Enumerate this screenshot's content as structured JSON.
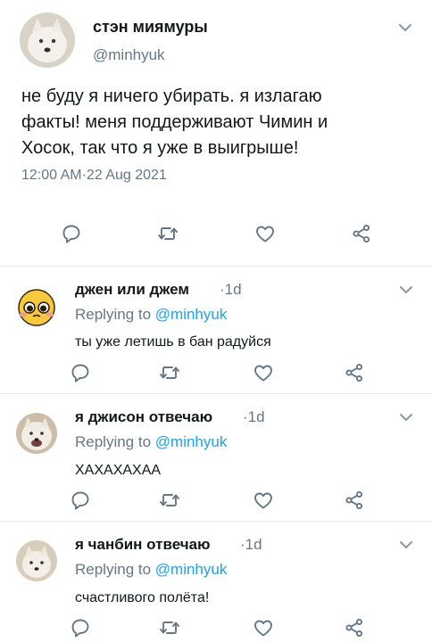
{
  "main_tweet": {
    "display_name": "стэн миямуры",
    "handle": "@minhyuk",
    "text": "не буду я ничего убирать. я излагаю\nфакты! меня поддерживают Чимин и\nХосок, так что я уже в выигрыше!",
    "timestamp": "12:00 AM·22 Aug 2021"
  },
  "replies": [
    {
      "display_name": "джен или джем",
      "time": "·1d",
      "replying_prefix": "Replying to ",
      "replying_handle": "@minhyuk",
      "text": "ты уже летишь в бан радуйся"
    },
    {
      "display_name": "я джисон отвечаю",
      "time": "·1d",
      "replying_prefix": "Replying to ",
      "replying_handle": "@minhyuk",
      "text": "ХАХАХАХАА"
    },
    {
      "display_name": "я чанбин отвечаю",
      "time": "·1d",
      "replying_prefix": "Replying to ",
      "replying_handle": "@minhyuk",
      "text": "счастливого полёта!"
    }
  ],
  "icons": [
    "chevron-down-icon",
    "reply-icon",
    "retweet-icon",
    "like-icon",
    "share-icon"
  ],
  "colors": {
    "text": "#14171a",
    "muted": "#657786",
    "link": "#1da1f2",
    "icon": "#657786",
    "divider": "#e1e8ed"
  }
}
